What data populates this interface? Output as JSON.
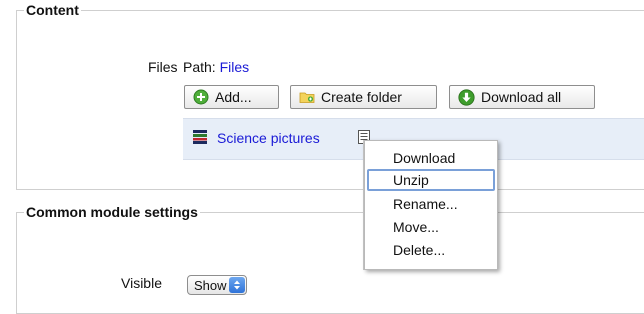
{
  "content_section": {
    "legend": "Content",
    "files_label": "Files",
    "path_prefix": "Path:",
    "path_link": "Files",
    "buttons": {
      "add": "Add...",
      "create_folder": "Create folder",
      "download_all": "Download all"
    },
    "file_item": "Science pictures"
  },
  "context_menu": {
    "items": [
      "Download",
      "Unzip",
      "Rename...",
      "Move...",
      "Delete..."
    ],
    "highlighted": "Unzip"
  },
  "common_section": {
    "legend": "Common module settings",
    "visible_label": "Visible",
    "visible_value": "Show"
  },
  "colors": {
    "link": "#1a1ad6",
    "highlight_border": "#7aa0d8",
    "file_band": "#e7eef8"
  },
  "icons": {
    "add": "plus-circle-icon",
    "create_folder": "folder-icon",
    "download_all": "download-arrow-icon",
    "file": "archive-icon",
    "menu_trigger": "menu-icon"
  }
}
